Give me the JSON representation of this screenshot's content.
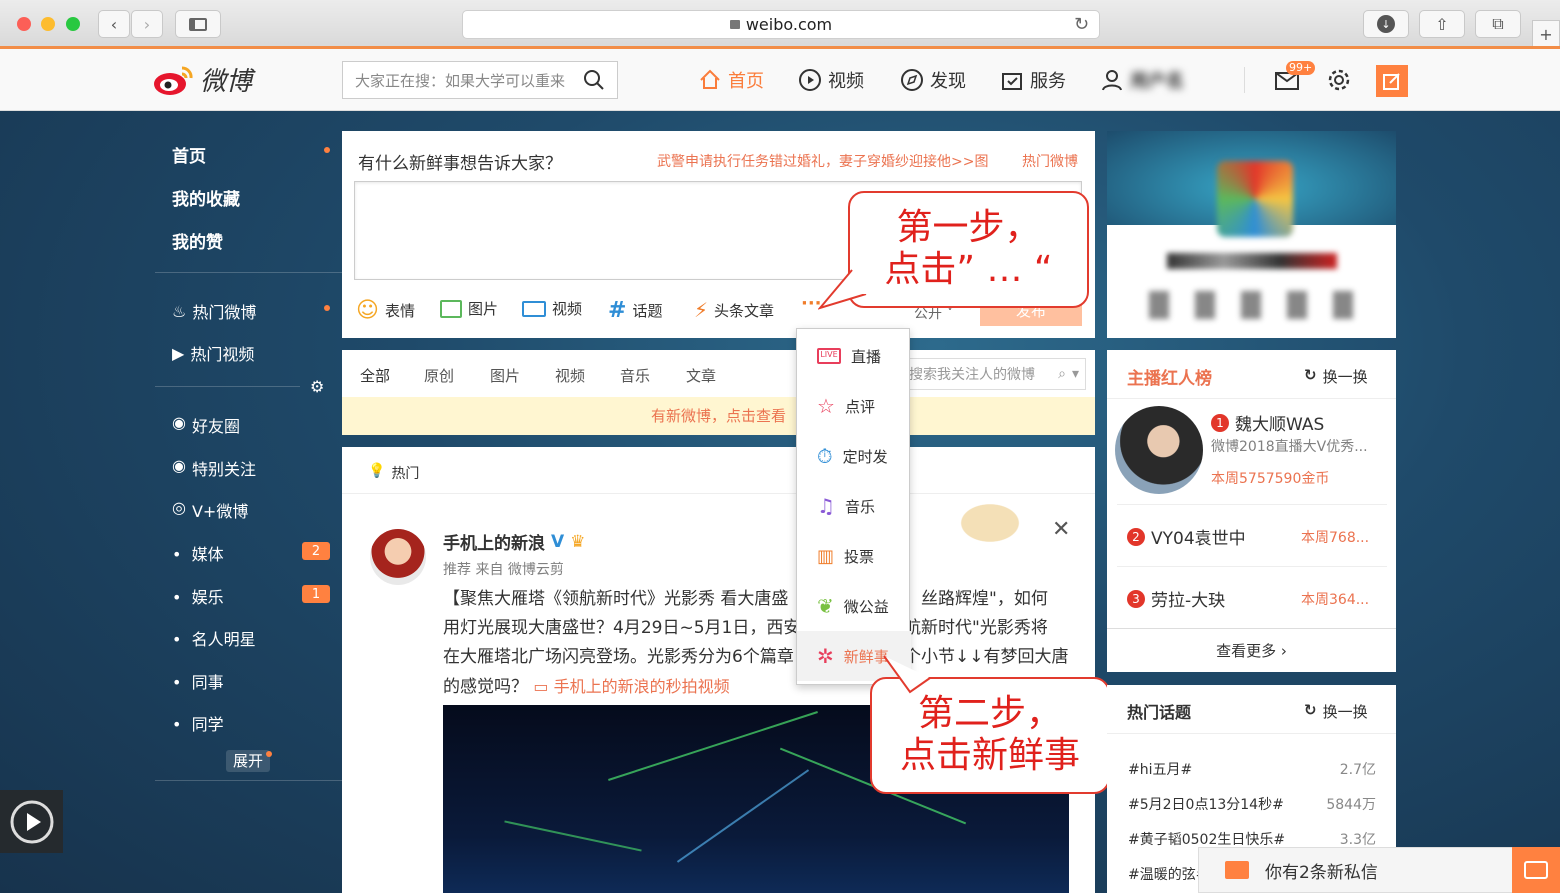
{
  "browser": {
    "url": "weibo.com"
  },
  "header": {
    "logo_text": "微博",
    "search_placeholder": "大家正在搜：如果大学可以重来",
    "nav": [
      {
        "label": "首页"
      },
      {
        "label": "视频"
      },
      {
        "label": "发现"
      },
      {
        "label": "服务"
      }
    ],
    "user_name": "用户名",
    "mail_badge": "99+"
  },
  "left_nav": {
    "top": [
      {
        "label": "首页"
      },
      {
        "label": "我的收藏"
      },
      {
        "label": "我的赞"
      }
    ],
    "hot": [
      {
        "label": "热门微博"
      },
      {
        "label": "热门视频"
      }
    ],
    "groups": [
      {
        "label": "好友圈"
      },
      {
        "label": "特别关注"
      },
      {
        "label": "V+微博"
      }
    ],
    "bullets": [
      {
        "label": "媒体",
        "badge": "2"
      },
      {
        "label": "娱乐",
        "badge": "1"
      },
      {
        "label": "名人明星"
      },
      {
        "label": "同事"
      },
      {
        "label": "同学"
      }
    ],
    "expand": "展开"
  },
  "composer": {
    "prompt": "有什么新鲜事想告诉大家？",
    "hot_link": "武警申请执行任务错过婚礼，妻子穿婚纱迎接他>>图",
    "hot_label": "热门微博",
    "tools": [
      {
        "label": "表情"
      },
      {
        "label": "图片"
      },
      {
        "label": "视频"
      },
      {
        "label": "话题"
      },
      {
        "label": "头条文章"
      }
    ],
    "more": "···",
    "visibility": "公开",
    "post": "发布"
  },
  "feed_tabs": {
    "tabs": [
      "全部",
      "原创",
      "图片",
      "视频",
      "音乐",
      "文章"
    ],
    "search_placeholder": "搜索我关注人的微博",
    "new_notice": "有新微博，点击查看"
  },
  "popup_menu": {
    "items": [
      {
        "label": "直播"
      },
      {
        "label": "点评"
      },
      {
        "label": "定时发"
      },
      {
        "label": "音乐"
      },
      {
        "label": "投票"
      },
      {
        "label": "微公益"
      },
      {
        "label": "新鲜事"
      }
    ]
  },
  "post": {
    "section": "热门",
    "author": "手机上的新浪",
    "meta": "推荐 来自 微博云剪",
    "lines": [
      "【聚焦大雁塔《领航新时代》光影秀 看大唐盛",
      "，丝路辉煌\"，如何",
      "用灯光展现大唐盛世？4月29日~5月1日，西安",
      "航新时代\"光影秀将",
      "在大雁塔北广场闪亮登场。光影秀分为6个篇章",
      "个小节↓↓有梦回大唐",
      "的感觉吗？"
    ],
    "video_link": "手机上的新浪的秒拍视频"
  },
  "callouts": {
    "step1": [
      "第一步，",
      "点击” … “"
    ],
    "step2": [
      "第二步，",
      "点击新鲜事"
    ]
  },
  "anchor_rank": {
    "title": "主播红人榜",
    "refresh": "换一换",
    "items": [
      {
        "rank": "1",
        "name": "魏大顺WAS",
        "desc": "微博2018直播大V优秀...",
        "coins": "本周5757590金币"
      },
      {
        "rank": "2",
        "name": "VY04袁世中",
        "coins": "本周768..."
      },
      {
        "rank": "3",
        "name": "劳拉-大玦",
        "coins": "本周364..."
      }
    ],
    "more": "查看更多 ›"
  },
  "hot_topics": {
    "title": "热门话题",
    "refresh": "换一换",
    "items": [
      {
        "tag": "#hi五月#",
        "count": "2.7亿"
      },
      {
        "tag": "#5月2日0点13分14秒#",
        "count": "5844万"
      },
      {
        "tag": "#黄子韬0502生日快乐#",
        "count": "3.3亿"
      },
      {
        "tag": "#温暖的弦#",
        "count": ""
      }
    ]
  },
  "message_bar": {
    "text": "你有2条新私信"
  },
  "colors": {
    "accent": "#ff8140",
    "callout": "#e0211c"
  }
}
